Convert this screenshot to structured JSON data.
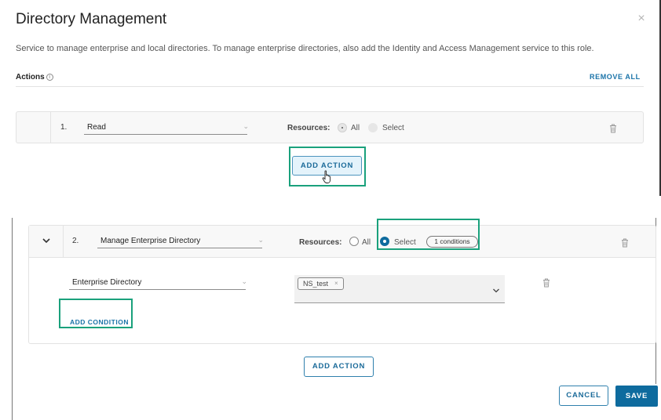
{
  "modal": {
    "title": "Directory Management",
    "close_icon": "×",
    "description": "Service to manage enterprise and local directories. To manage enterprise directories, also add the Identity and Access Management service to this role.",
    "actions_label": "Actions",
    "info_icon": "i",
    "remove_all_label": "REMOVE ALL"
  },
  "action_1": {
    "number": "1.",
    "action_value": "Read",
    "resources_label": "Resources:",
    "options": [
      "All",
      "Select"
    ],
    "selected": "All"
  },
  "add_action_label": "ADD ACTION",
  "action_2": {
    "number": "2.",
    "action_value": "Manage Enterprise Directory",
    "resources_label": "Resources:",
    "options": [
      "All",
      "Select"
    ],
    "selected": "Select",
    "conditions_badge": "1 conditions",
    "condition": {
      "field_value": "Enterprise Directory",
      "tags": [
        {
          "label": "NS_test",
          "remove_icon": "×"
        }
      ]
    },
    "add_condition_label": "ADD CONDITION"
  },
  "footer": {
    "cancel_label": "CANCEL",
    "save_label": "SAVE"
  },
  "colors": {
    "accent": "#1a73a8",
    "primary_button": "#0e6b9e",
    "highlight_box": "#1aa17c"
  }
}
